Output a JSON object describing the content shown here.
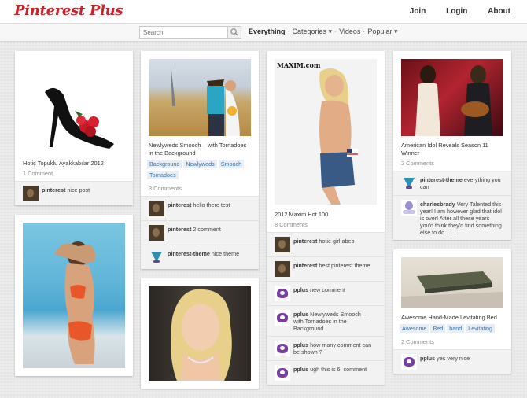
{
  "header": {
    "logo": "Pinterest Plus",
    "nav": [
      "Join",
      "Login",
      "About"
    ]
  },
  "subbar": {
    "search_placeholder": "Search",
    "cat_everything": "Everything",
    "cat_categories": "Categories ▾",
    "cat_videos": "Videos",
    "cat_popular": "Popular ▾"
  },
  "pins": {
    "shoe": {
      "title": "Hotiç Topuklu Ayakkabılar 2012",
      "count": "1 Comment",
      "comments": [
        {
          "user": "pinterest",
          "text": "nice post"
        }
      ]
    },
    "couple": {
      "title": "Newlyweds Smooch – with Tornadoes in the Background",
      "count": "3 Comments",
      "tags": [
        "Background",
        "Newlyweds",
        "Smooch",
        "Tornadoes"
      ],
      "comments": [
        {
          "user": "pinterest",
          "text": "hello there test"
        },
        {
          "user": "pinterest",
          "text": "2 comment"
        },
        {
          "user": "pinterest-theme",
          "text": "nice theme"
        }
      ]
    },
    "maxim": {
      "title": "2012 Maxim Hot 100",
      "count": "8 Comments",
      "brand": "MAXIM.com",
      "comments": [
        {
          "user": "pinterest",
          "text": "hotie girl abeb"
        },
        {
          "user": "pinterest",
          "text": "best pinterest theme"
        },
        {
          "user": "pplus",
          "text": "new comment"
        },
        {
          "user": "pplus",
          "text": "Newlyweds Smooch – with Tornadoes in the Background"
        },
        {
          "user": "pplus",
          "text": "how many comment can be shown ?"
        },
        {
          "user": "pplus",
          "text": "ugh this is 6. comment"
        }
      ]
    },
    "idol": {
      "title": "American Idol Reveals Season 11 Winner",
      "count": "2 Comments",
      "comments": [
        {
          "user": "pinterest-theme",
          "text": "everything you can"
        },
        {
          "user": "charlesbrady",
          "text": "Very Talented this year! I am however glad that idol is over! After all these years you'd think they'd find something else to do…….."
        }
      ]
    },
    "bed": {
      "title": "Awesome Hand-Made Levitating Bed",
      "count": "2 Comments",
      "tags": [
        "Awesome",
        "Bed",
        "hand",
        "Levitating"
      ],
      "comments": [
        {
          "user": "pplus",
          "text": "yes very nice"
        }
      ]
    }
  },
  "colors": {
    "logo_red": "#c8232c",
    "tag_bg": "#e8eef5",
    "tag_text": "#3a6fa8"
  }
}
